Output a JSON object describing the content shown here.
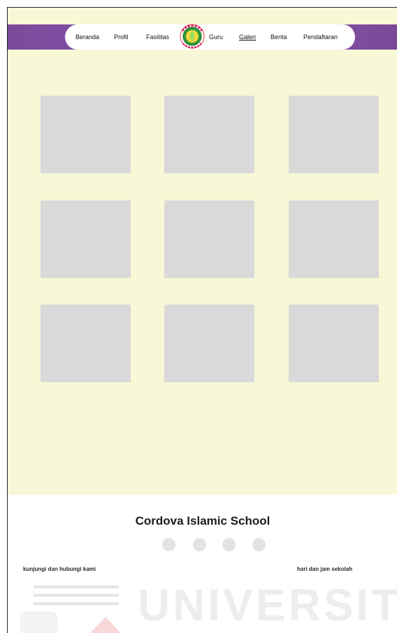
{
  "nav": {
    "items": [
      {
        "label": "Beranda"
      },
      {
        "label": "Profil"
      },
      {
        "label": "Fasilitas"
      },
      {
        "label": "Guru"
      },
      {
        "label": "Galeri"
      },
      {
        "label": "Berita"
      },
      {
        "label": "Pendaftaran"
      }
    ],
    "active": "Galeri",
    "logo_text": "CORDOVA ISLAMIC SCHOOL"
  },
  "gallery": {
    "tile_count": 9
  },
  "footer": {
    "title": "Cordova Islamic School",
    "contact_label": "kunjungi dan hubungi kami",
    "hours_label": "hari dan jam sekolah",
    "social_dot_count": 4
  },
  "watermark": {
    "text": "UNIVERSITA"
  },
  "colors": {
    "nav_bar": "#8a53ad",
    "page_bg": "#f8f7d6",
    "tile": "#d9d9d9",
    "footer_bg": "#ffffff"
  }
}
